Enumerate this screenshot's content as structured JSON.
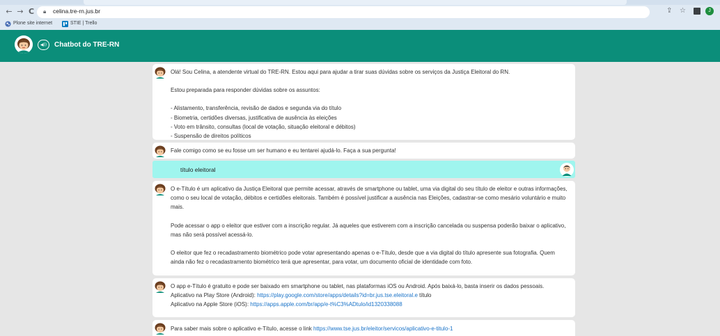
{
  "browser": {
    "back_glyph": "←",
    "forward_glyph": "→",
    "reload_glyph": "C",
    "url": "celina.tre-rn.jus.br",
    "share_glyph": "⇪",
    "star_glyph": "☆",
    "profile_initial": "J",
    "bookmarks": [
      {
        "label": "Plone site internet",
        "icon": "plone-icon"
      },
      {
        "label": "STIE | Trello",
        "icon": "trello-icon"
      }
    ]
  },
  "header": {
    "title": "Chatbot do TRE-RN",
    "audio_glyph": "◀))"
  },
  "chat": {
    "messages": [
      {
        "from": "bot",
        "paragraphs": [
          "Olá! Sou Celina, a atendente virtual do TRE-RN. Estou aqui para ajudar a tirar suas dúvidas sobre os serviços da Justiça Eleitoral do RN.",
          "Estou preparada para responder dúvidas sobre os assuntos:",
          "- Alistamento, transferência, revisão de dados e segunda via do título",
          "- Biometria, certidões diversas, justificativa de ausência às eleições",
          "- Voto em trânsito, consultas (local de votação, situação eleitoral e débitos)",
          "- Suspensão de direitos políticos"
        ]
      },
      {
        "from": "bot",
        "paragraphs": [
          "Fale comigo como se eu fosse um ser humano e eu tentarei ajudá-lo. Faça a sua pergunta!"
        ]
      },
      {
        "from": "user",
        "text": "título eleitoral"
      },
      {
        "from": "bot",
        "paragraphs": [
          "O e-Título é um aplicativo da Justiça Eleitoral que permite acessar, através de smartphone ou tablet, uma via digital do seu título de eleitor e outras informações, como o seu local de votação, débitos e certidões eleitorais. Também é possível justificar a ausência nas Eleições, cadastrar-se como mesário voluntário e muito mais.",
          "Pode acessar o app o eleitor que estiver com a inscrição regular. Já aqueles que estiverem com a inscrição cancelada ou suspensa poderão baixar o aplicativo, mas não será possível acessá-lo.",
          "O eleitor que fez o recadastramento biométrico pode votar apresentando apenas o e-Título, desde que a via digital do título apresente sua fotografia. Quem ainda não fez o recadastramento biométrico terá que apresentar, para votar, um documento oficial de identidade com foto."
        ]
      },
      {
        "from": "bot",
        "intro": "O app e-Título é gratuito e pode ser baixado em smartphone ou tablet, nas plataformas iOS ou Android. Após baixá-lo, basta inserir os dados pessoais.",
        "android_label": "Aplicativo na Play Store (Android): ",
        "android_link": "https://play.google.com/store/apps/details?id=br.jus.tse.eleitoral.e",
        "android_suffix": " título",
        "ios_label": "Aplicativo na Apple Store (iOS): ",
        "ios_link": "https://apps.apple.com/br/app/e-t%C3%ADtulo/id1320338088"
      },
      {
        "from": "bot",
        "text": "Para saber mais sobre o aplicativo e-Título, acesse o link ",
        "link": "https://www.tse.jus.br/eleitor/servicos/aplicativo-e-titulo-1"
      }
    ]
  },
  "colors": {
    "header_bg": "#0b8e7a",
    "user_bubble": "#9ff5ee",
    "link": "#1a73c8",
    "page_bg": "#e6e6e6"
  }
}
